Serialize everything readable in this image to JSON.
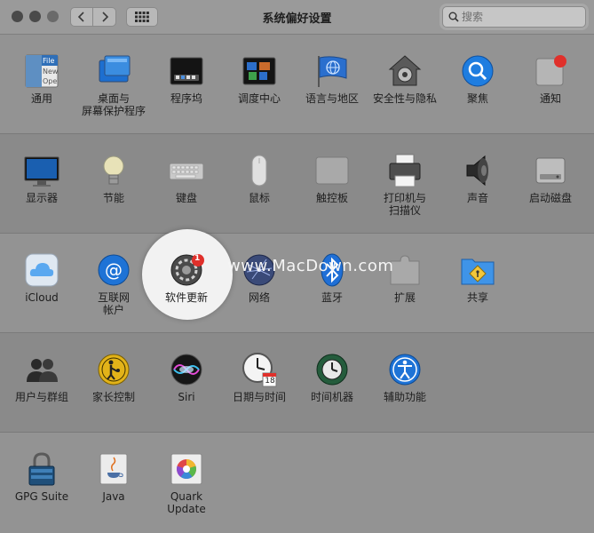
{
  "window": {
    "title": "系统偏好设置"
  },
  "search": {
    "placeholder": "搜索"
  },
  "watermark": "www.MacDown.com",
  "sections": [
    {
      "panes": [
        {
          "label": "通用",
          "icon": "general-icon"
        },
        {
          "label": "桌面与\n屏幕保护程序",
          "icon": "desktop-icon"
        },
        {
          "label": "程序坞",
          "icon": "dock-icon"
        },
        {
          "label": "调度中心",
          "icon": "mission-control-icon"
        },
        {
          "label": "语言与地区",
          "icon": "globe-flag-icon"
        },
        {
          "label": "安全性与隐私",
          "icon": "security-house-icon"
        },
        {
          "label": "聚焦",
          "icon": "spotlight-icon"
        },
        {
          "label": "通知",
          "icon": "notifications-icon"
        }
      ]
    },
    {
      "panes": [
        {
          "label": "显示器",
          "icon": "display-icon"
        },
        {
          "label": "节能",
          "icon": "energy-bulb-icon"
        },
        {
          "label": "键盘",
          "icon": "keyboard-icon"
        },
        {
          "label": "鼠标",
          "icon": "mouse-icon"
        },
        {
          "label": "触控板",
          "icon": "trackpad-icon"
        },
        {
          "label": "打印机与\n扫描仪",
          "icon": "printer-icon"
        },
        {
          "label": "声音",
          "icon": "speaker-icon"
        },
        {
          "label": "启动磁盘",
          "icon": "startup-disk-icon"
        }
      ]
    },
    {
      "panes": [
        {
          "label": "iCloud",
          "icon": "icloud-icon"
        },
        {
          "label": "互联网\n帐户",
          "icon": "internet-accounts-icon"
        },
        {
          "label": "软件更新",
          "icon": "software-update-icon",
          "badge": "1"
        },
        {
          "label": "网络",
          "icon": "network-icon"
        },
        {
          "label": "蓝牙",
          "icon": "bluetooth-icon"
        },
        {
          "label": "扩展",
          "icon": "extensions-icon"
        },
        {
          "label": "共享",
          "icon": "sharing-icon"
        }
      ]
    },
    {
      "panes": [
        {
          "label": "用户与群组",
          "icon": "users-icon"
        },
        {
          "label": "家长控制",
          "icon": "parental-controls-icon"
        },
        {
          "label": "Siri",
          "icon": "siri-icon"
        },
        {
          "label": "日期与时间",
          "icon": "clock-calendar-icon",
          "calendar_day": "18"
        },
        {
          "label": "时间机器",
          "icon": "time-machine-icon"
        },
        {
          "label": "辅助功能",
          "icon": "accessibility-icon"
        }
      ]
    },
    {
      "panes": [
        {
          "label": "GPG Suite",
          "icon": "gpg-lock-icon"
        },
        {
          "label": "Java",
          "icon": "java-icon"
        },
        {
          "label": "Quark\nUpdate",
          "icon": "quark-update-icon"
        }
      ]
    }
  ],
  "general_icon_text": [
    "File",
    "New",
    "Ope"
  ]
}
